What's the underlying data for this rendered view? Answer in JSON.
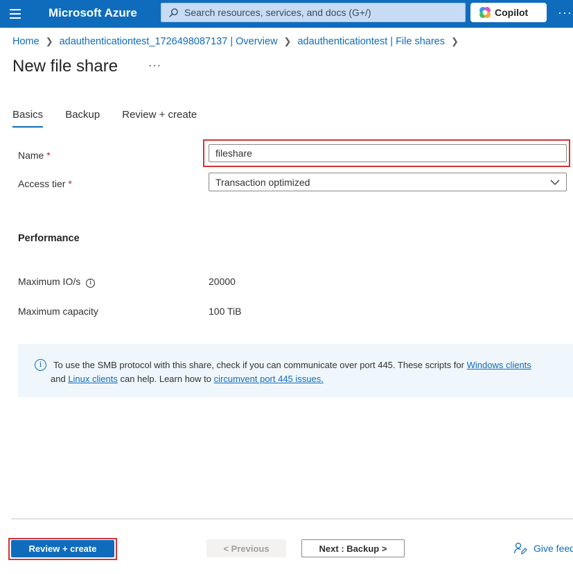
{
  "topbar": {
    "brand": "Microsoft Azure",
    "search_placeholder": "Search resources, services, and docs (G+/)",
    "copilot_label": "Copilot",
    "more": "···"
  },
  "breadcrumb": [
    "Home",
    "adauthenticationtest_1726498087137 | Overview",
    "adauthenticationtest | File shares"
  ],
  "page": {
    "title": "New file share",
    "more": "···"
  },
  "tabs": [
    "Basics",
    "Backup",
    "Review + create"
  ],
  "form": {
    "name_label": "Name",
    "name_value": "fileshare",
    "access_tier_label": "Access tier",
    "access_tier_value": "Transaction optimized",
    "required_mark": "*"
  },
  "performance": {
    "heading": "Performance",
    "max_iops_label": "Maximum IO/s",
    "max_iops_value": "20000",
    "max_capacity_label": "Maximum capacity",
    "max_capacity_value": "100 TiB"
  },
  "banner": {
    "text_1": "To use the SMB protocol with this share, check if you can communicate over port 445. These scripts for ",
    "link_windows": "Windows clients",
    "text_2": " and ",
    "link_linux": "Linux clients",
    "text_3": " can help. Learn how to ",
    "link_port": "circumvent port 445 issues."
  },
  "footer": {
    "review_create": "Review + create",
    "previous": "< Previous",
    "next": "Next : Backup >",
    "feedback": "Give feedback"
  },
  "colors": {
    "accent": "#0f6cbd",
    "highlight": "#d13438",
    "banner_bg": "#eff6fc"
  }
}
